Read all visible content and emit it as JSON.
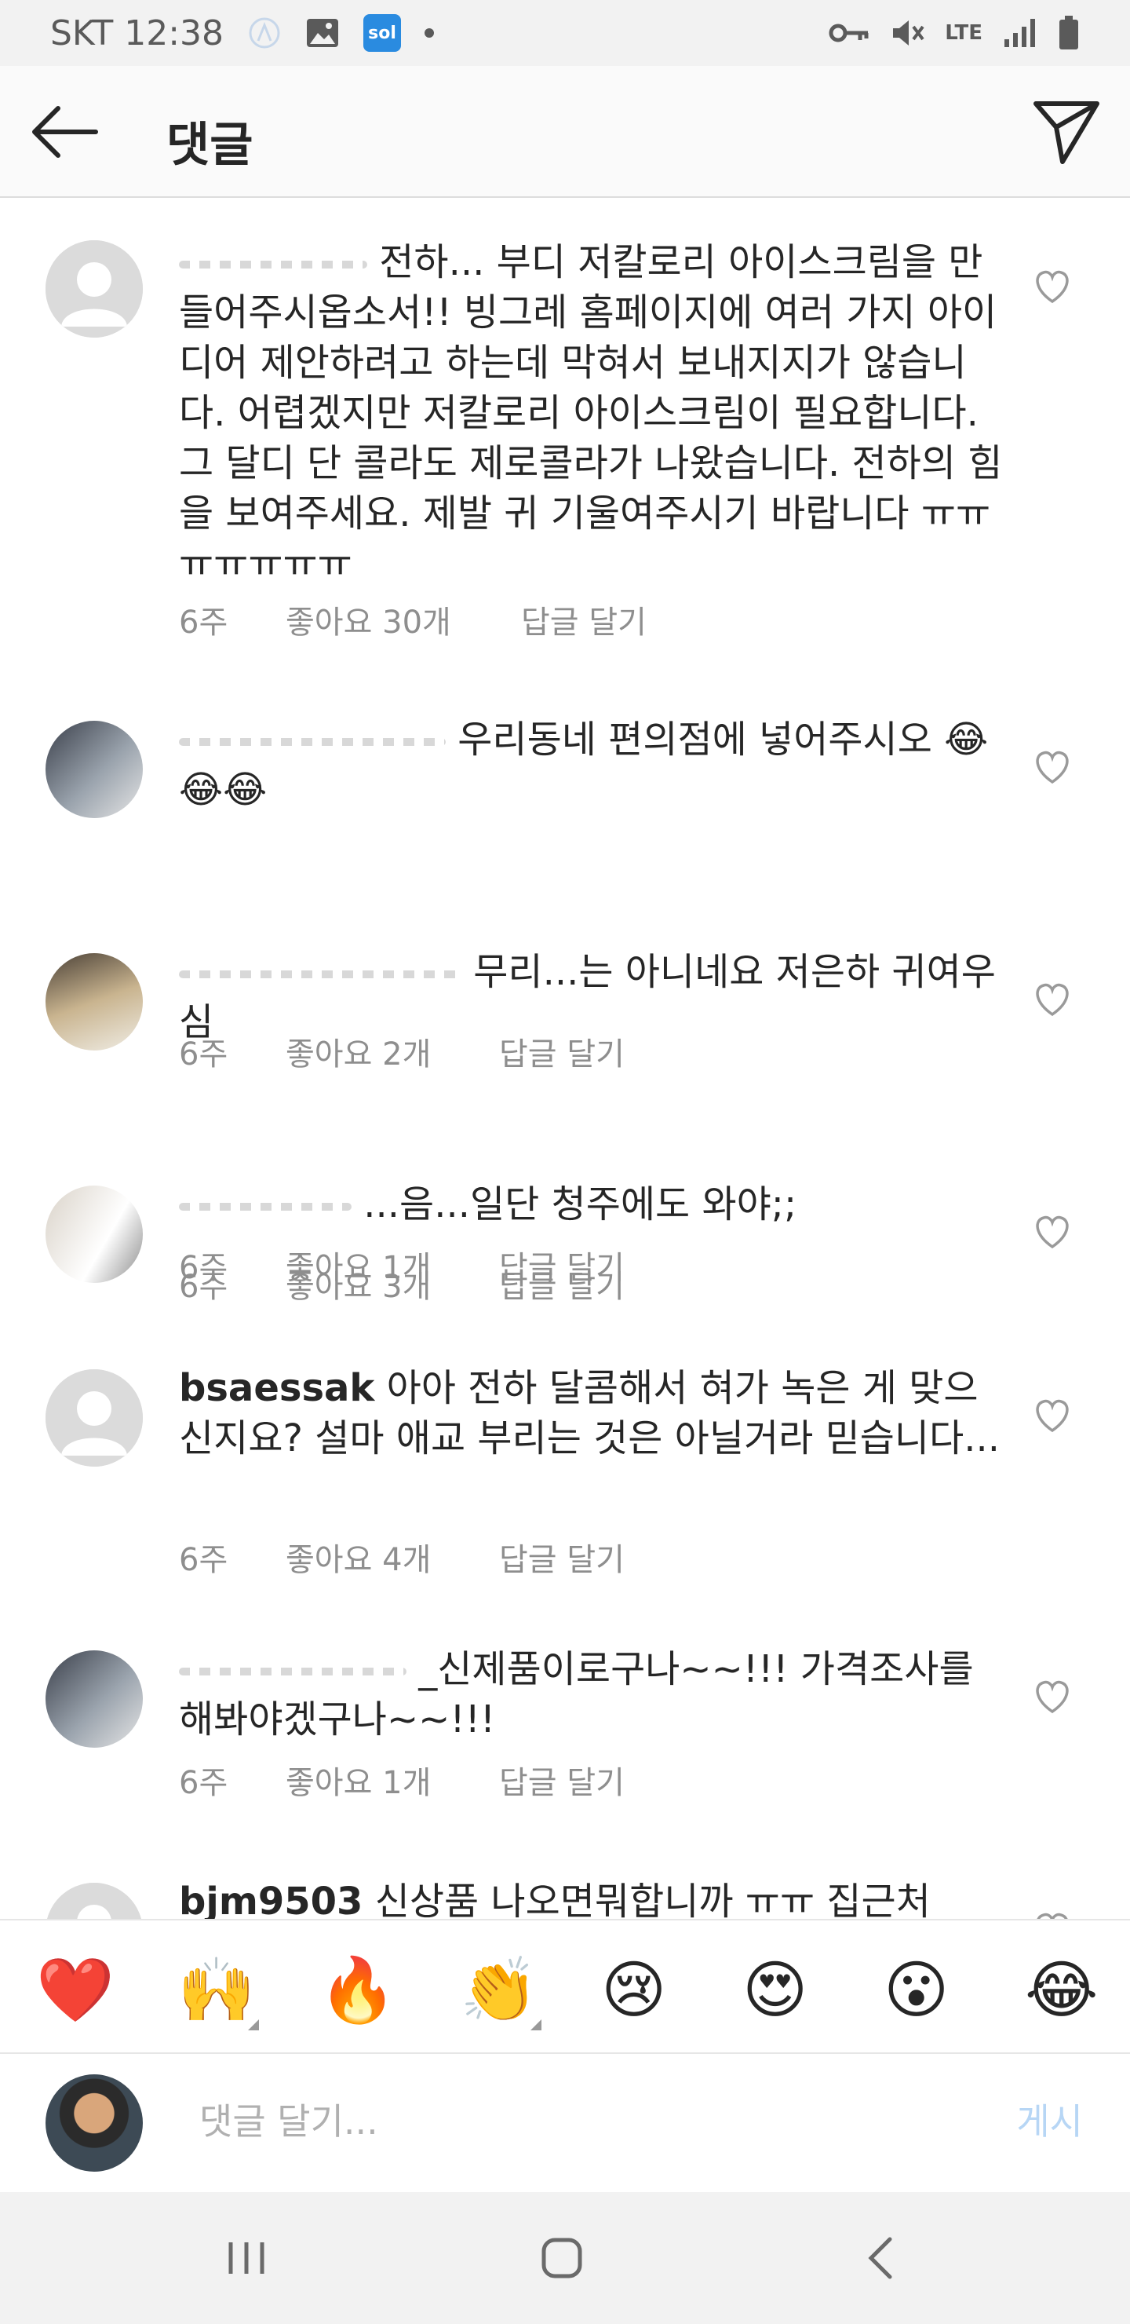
{
  "status_bar": {
    "carrier_time": "SKT 12:38",
    "sol_badge": "sol",
    "net": "LTE"
  },
  "header": {
    "title": "댓글"
  },
  "comments": [
    {
      "username": "",
      "text": "전하... 부디 저칼로리 아이스크림을 만들어주시옵소서!! 빙그레 홈페이지에 여러 가지 아이디어 제안하려고 하는데 막혀서 보내지지가 않습니다. 어렵겠지만 저칼로리 아이스크림이 필요합니다. 그 달디 단 콜라도 제로콜라가 나왔습니다. 전하의 힘을 보여주세요. 제발 귀 기울여주시기 바랍니다 ㅠㅠㅠㅠㅠㅠㅠ",
      "time": "6주",
      "likes": "좋아요 30개",
      "reply": "답글 달기"
    },
    {
      "username": "",
      "text": "우리동네 편의점에 넣어주시오 😂😂😂",
      "time": "6주",
      "likes": "좋아요 2개",
      "reply": "답글 달기"
    },
    {
      "username": "",
      "text": "무리...는 아니네요 저은하 귀여우심",
      "time": "6주",
      "likes": "좋아요 3개",
      "reply": "답글 달기"
    },
    {
      "username": "",
      "text": "...음...일단 청주에도 와야;;",
      "time": "6주",
      "likes": "좋아요 1개",
      "reply": "답글 달기"
    },
    {
      "username": "bsaessak",
      "text": "아아 전하 달콤해서 혀가 녹은 게 맞으신지요? 설마 애교 부리는 것은 아닐거라 믿습니다...",
      "time": "6주",
      "likes": "좋아요 4개",
      "reply": "답글 달기"
    },
    {
      "username": "",
      "text": "_신제품이로구나~~!!! 가격조사를 해봐야겠구나~~!!!",
      "time": "6주",
      "likes": "좋아요 1개",
      "reply": "답글 달기"
    },
    {
      "username": "bjm9503",
      "text": "신상품 나오면뭐합니까 ㅠㅠ 집근처",
      "time": "",
      "likes": "",
      "reply": ""
    }
  ],
  "emoji_bar": [
    "❤️",
    "🙌",
    "🔥",
    "👏",
    "😢",
    "😍",
    "😮",
    "😂"
  ],
  "compose": {
    "placeholder": "댓글 달기...",
    "post_label": "게시"
  }
}
